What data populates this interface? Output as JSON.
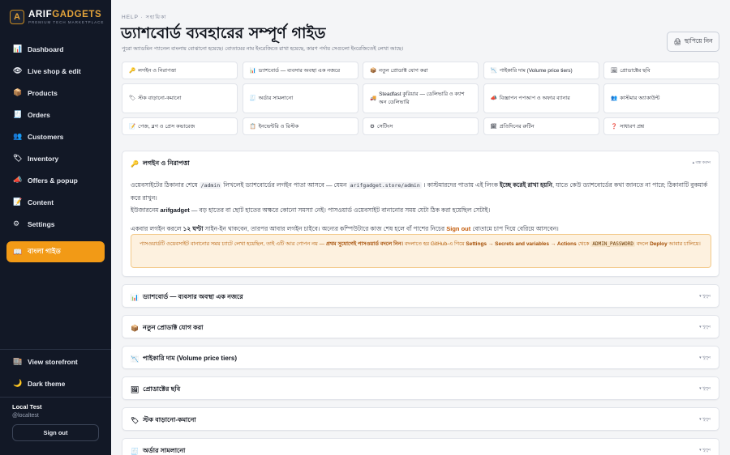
{
  "brand": {
    "name_main": "ARIF",
    "name_accent": "GADGETS",
    "tagline": "PREMIUM TECH MARKETPLACE",
    "logo_letter": "A"
  },
  "sidebar": {
    "items": [
      {
        "icon": "📊",
        "label": "Dashboard"
      },
      {
        "icon": "👁",
        "label": "Live shop & edit"
      },
      {
        "icon": "📦",
        "label": "Products"
      },
      {
        "icon": "🧾",
        "label": "Orders"
      },
      {
        "icon": "👥",
        "label": "Customers"
      },
      {
        "icon": "🏷",
        "label": "Inventory"
      },
      {
        "icon": "📣",
        "label": "Offers & popup"
      },
      {
        "icon": "📝",
        "label": "Content"
      },
      {
        "icon": "⚙",
        "label": "Settings"
      }
    ],
    "active": {
      "icon": "📖",
      "label": "বাংলা গাইড"
    },
    "bottom": [
      {
        "icon": "🏬",
        "label": "View storefront"
      },
      {
        "icon": "🌙",
        "label": "Dark theme"
      }
    ],
    "user": {
      "name": "Local Test",
      "handle": "@localtest"
    },
    "signout_label": "Sign out"
  },
  "header": {
    "breadcrumb": "HELP · সহায়িকা",
    "title": "ড্যাশবোর্ড ব্যবহারের সম্পূর্ণ গাইড",
    "subtitle": "পুরো অ্যাডমিন প্যানেল বাংলায় বোঝানো হয়েছে। বোতামের নাম ইংরেজিতে রাখা হয়েছে, কারণ পর্দায় সেগুলো ইংরেজিতেই লেখা আছে।",
    "print_label": "ছাপিয়ে নিন",
    "print_icon": "🖨"
  },
  "topics": [
    {
      "icon": "🔑",
      "label": "লগইন ও নিরাপত্তা"
    },
    {
      "icon": "📊",
      "label": "ড্যাশবোর্ড — ব্যবসার অবস্থা এক নজরে"
    },
    {
      "icon": "📦",
      "label": "নতুন প্রোডাক্ট যোগ করা"
    },
    {
      "icon": "📉",
      "label": "পাইকারি দাম (Volume price tiers)"
    },
    {
      "icon": "🖼",
      "label": "প্রোডাক্টের ছবি"
    },
    {
      "icon": "🏷",
      "label": "স্টক বাড়ানো-কমানো"
    },
    {
      "icon": "🧾",
      "label": "অর্ডার সামলানো"
    },
    {
      "icon": "🚚",
      "label": "Steadfast কুরিয়ার — ডেলিভারি ও ক্যাশ অন ডেলিভারি"
    },
    {
      "icon": "📣",
      "label": "বিজ্ঞাপন পপআপ ও অফার ব্যানার"
    },
    {
      "icon": "👥",
      "label": "কাস্টমার অ্যাকাউন্ট"
    },
    {
      "icon": "📝",
      "label": "পেজ, ব্লগ ও প্রেস কভারেজ"
    },
    {
      "icon": "📋",
      "label": "ইনভেন্টরি ও রিস্টক"
    },
    {
      "icon": "⚙",
      "label": "সেটিংস"
    },
    {
      "icon": "🗓",
      "label": "প্রতিদিনের রুটিন"
    },
    {
      "icon": "❓",
      "label": "সাধারণ প্রশ্ন"
    }
  ],
  "login_section": {
    "icon": "🔑",
    "title": "লগইন ও নিরাপত্তা",
    "toggle": "▴ বন্ধ করুন",
    "p1_a": "ওয়েবসাইটের ঠিকানার শেষে",
    "p1_code1": "/admin",
    "p1_b": "লিখলেই ড্যাশবোর্ডের লগইন পাতা আসবে — যেমন",
    "p1_code2": "arifgadget.store/admin",
    "p1_c": "। কাস্টমারদের পাতায় এই লিংক",
    "p1_bold": "ইচ্ছে করেই রাখা হয়নি",
    "p1_d": ", যাতে কেউ ড্যাশবোর্ডের কথা জানতে না পারে; ঠিকানাটি বুকমার্ক করে রাখুন।",
    "p2_a": "ইউজারনেম",
    "p2_bold": "arifgadget",
    "p2_b": "— বড় হাতের বা ছোট হাতের অক্ষরে কোনো সমস্যা নেই। পাসওয়ার্ড ওয়েবসাইট বানানোর সময় যেটা ঠিক করা হয়েছিল সেটাই।",
    "p3_a": "একবার লগইন করলে",
    "p3_bold": "১২ ঘণ্টা",
    "p3_b": "সাইন-ইন থাকবেন, তারপর আবার লগইন চাইবে। অন্যের কম্পিউটারে কাজ শেষ হলে বাঁ পাশের নিচের",
    "p3_orange": "Sign out",
    "p3_c": "বোতামে চাপ দিয়ে বেরিয়ে আসবেন।",
    "callout_a": "পাসওয়ার্ডটি ওয়েবসাইট বানানোর সময় চ্যাটে লেখা হয়েছিল, তাই এটি আর গোপন নয় —",
    "callout_bold1": "প্রথম সুযোগেই পাসওয়ার্ড বদলে নিন।",
    "callout_b": "বদলাতে হয় GitHub-এ গিয়ে",
    "callout_bold2": "Settings → Secrets and variables → Actions",
    "callout_c": "থেকে",
    "callout_code": "ADMIN_PASSWORD",
    "callout_d": "বদলে",
    "callout_bold3": "Deploy",
    "callout_e": "আবার চালিয়ে।"
  },
  "collapsed_sections": [
    {
      "icon": "📊",
      "title": "ড্যাশবোর্ড — ব্যবসার অবস্থা এক নজরে",
      "toggle": "▾ খুলুন"
    },
    {
      "icon": "📦",
      "title": "নতুন প্রোডাক্ট যোগ করা",
      "toggle": "▾ খুলুন"
    },
    {
      "icon": "📉",
      "title": "পাইকারি দাম (Volume price tiers)",
      "toggle": "▾ খুলুন"
    },
    {
      "icon": "🖼",
      "title": "প্রোডাক্টের ছবি",
      "toggle": "▾ খুলুন"
    },
    {
      "icon": "🏷",
      "title": "স্টক বাড়ানো-কমানো",
      "toggle": "▾ খুলুন"
    },
    {
      "icon": "🧾",
      "title": "অর্ডার সামলানো",
      "toggle": "▾ খুলুন"
    }
  ],
  "colors": {
    "accent": "#f29a16",
    "sidebar_bg": "#121826",
    "callout_bg": "#fdf1df"
  }
}
